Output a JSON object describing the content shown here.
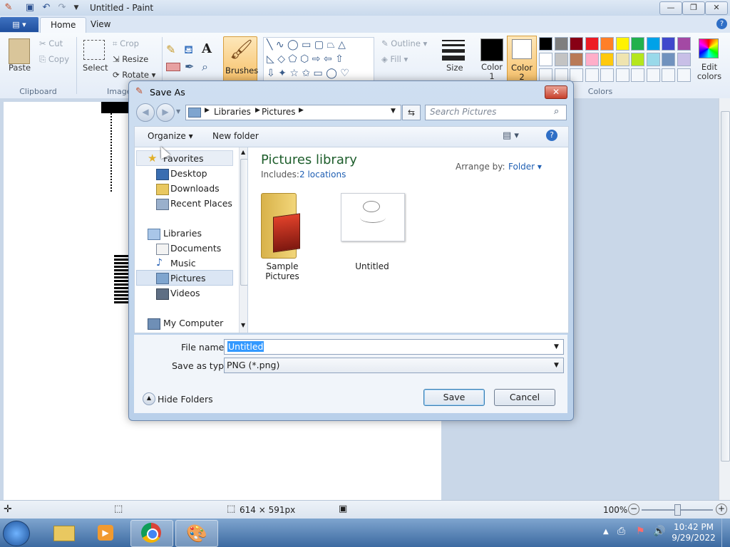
{
  "app": {
    "title": "Untitled - Paint"
  },
  "tabs": [
    "Home",
    "View"
  ],
  "ribbon": {
    "clipboard": {
      "label": "Clipboard",
      "paste": "Paste",
      "cut": "Cut",
      "copy": "Copy"
    },
    "image": {
      "label": "Image",
      "select": "Select",
      "crop": "Crop",
      "resize": "Resize",
      "rotate": "Rotate"
    },
    "brushes": "Brushes",
    "shapes": {
      "outline": "Outline",
      "fill": "Fill"
    },
    "size": "Size",
    "color1": "Color 1",
    "color2": "Color 2",
    "colors_label": "Colors",
    "edit_colors": "Edit colors",
    "palette": [
      "#000000",
      "#7f7f7f",
      "#880015",
      "#ed1c24",
      "#ff7f27",
      "#fff200",
      "#22b14c",
      "#00a2e8",
      "#3f48cc",
      "#a349a4",
      "#ffffff",
      "#c3c3c3",
      "#b97a57",
      "#ffaec9",
      "#ffc90e",
      "#efe4b0",
      "#b5e61d",
      "#99d9ea",
      "#7092be",
      "#c8bfe7"
    ]
  },
  "status": {
    "size": "614 × 591px",
    "zoom": "100%"
  },
  "taskbar": {
    "time": "10:42 PM",
    "date": "9/29/2022"
  },
  "dialog": {
    "title": "Save As",
    "breadcrumb": [
      "Libraries",
      "Pictures"
    ],
    "search_placeholder": "Search Pictures",
    "organize": "Organize",
    "new_folder": "New folder",
    "nav": {
      "favorites": "Favorites",
      "desktop": "Desktop",
      "downloads": "Downloads",
      "recent": "Recent Places",
      "libraries": "Libraries",
      "documents": "Documents",
      "music": "Music",
      "pictures": "Pictures",
      "videos": "Videos",
      "computer": "My Computer"
    },
    "library_title": "Pictures library",
    "includes_label": "Includes:",
    "includes_link": "2 locations",
    "arrange_label": "Arrange by:",
    "arrange_value": "Folder",
    "items": [
      "Sample Pictures",
      "Untitled"
    ],
    "filename_label": "File name:",
    "filename_value": "Untitled",
    "type_label": "Save as type:",
    "type_value": "PNG (*.png)",
    "hide_folders": "Hide Folders",
    "save": "Save",
    "cancel": "Cancel"
  }
}
